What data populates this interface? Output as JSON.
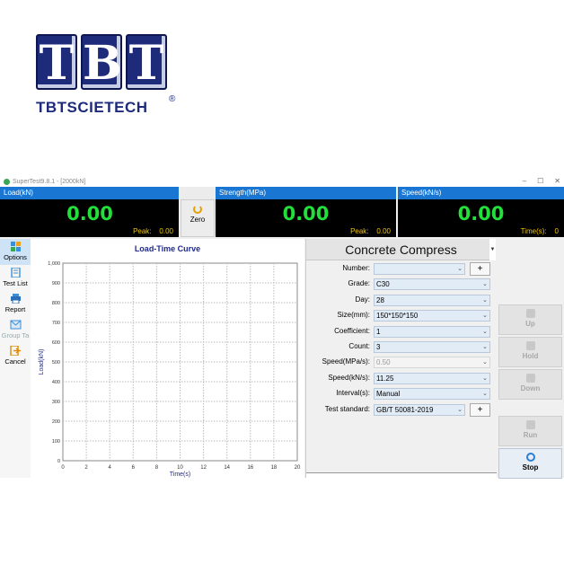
{
  "logo": {
    "letters": [
      "T",
      "B",
      "T"
    ],
    "brand": "TBTSCIETECH",
    "reg": "®"
  },
  "window": {
    "title": "SuperTest9.8.1 - [2000kN]",
    "controls": [
      "–",
      "☐",
      "✕"
    ]
  },
  "readouts": [
    {
      "label": "Load(kN)",
      "value": "0.00",
      "sub_label": "Peak:",
      "sub_value": "0.00"
    },
    {
      "label": "Strength(MPa)",
      "value": "0.00",
      "sub_label": "Peak:",
      "sub_value": "0.00"
    },
    {
      "label": "Speed(kN/s)",
      "value": "0.00",
      "sub_label": "Time(s):",
      "sub_value": "0"
    }
  ],
  "zero_button": "Zero",
  "toolbar": [
    {
      "label": "Options",
      "icon": "grid-icon",
      "active": true
    },
    {
      "label": "Test List",
      "icon": "list-icon",
      "active": false
    },
    {
      "label": "Report",
      "icon": "printer-icon",
      "active": false
    },
    {
      "label": "Group Ta",
      "icon": "envelope-icon",
      "active": false
    },
    {
      "label": "Cancel",
      "icon": "exit-icon",
      "active": false
    }
  ],
  "chart_data": {
    "type": "line",
    "title": "Load-Time Curve",
    "xlabel": "Time(s)",
    "ylabel": "Load(kN)",
    "xlim": [
      0,
      20
    ],
    "ylim": [
      0,
      1000
    ],
    "x_ticks": [
      0,
      2,
      4,
      6,
      8,
      10,
      12,
      14,
      16,
      18,
      20
    ],
    "y_ticks": [
      0,
      100,
      200,
      300,
      400,
      500,
      600,
      700,
      800,
      900,
      1000
    ],
    "y_tick_labels": [
      "0",
      "100",
      "200",
      "300",
      "400",
      "500",
      "600",
      "700",
      "800",
      "900",
      "1,000"
    ],
    "grid": true,
    "series": []
  },
  "params": {
    "header": "Concrete Compress",
    "rows": [
      {
        "label": "Number:",
        "value": "",
        "plus": true,
        "disabled": false
      },
      {
        "label": "Grade:",
        "value": "C30",
        "plus": false,
        "disabled": false
      },
      {
        "label": "Day:",
        "value": "28",
        "plus": false,
        "disabled": false
      },
      {
        "label": "Size(mm):",
        "value": "150*150*150",
        "plus": false,
        "disabled": false
      },
      {
        "label": "Coefficient:",
        "value": "1",
        "plus": false,
        "disabled": false
      },
      {
        "label": "Count:",
        "value": "3",
        "plus": false,
        "disabled": false
      },
      {
        "label": "Speed(MPa/s):",
        "value": "0.50",
        "plus": false,
        "disabled": true
      },
      {
        "label": "Speed(kN/s):",
        "value": "11.25",
        "plus": false,
        "disabled": false
      },
      {
        "label": "Interval(s):",
        "value": "Manual",
        "plus": false,
        "disabled": false
      },
      {
        "label": "Test standard:",
        "value": "GB/T 50081-2019",
        "plus": true,
        "disabled": false
      }
    ],
    "plus_label": "+"
  },
  "controls": [
    {
      "label": "Up",
      "enabled": false
    },
    {
      "label": "Hold",
      "enabled": false
    },
    {
      "label": "Down",
      "enabled": false
    },
    {
      "label": "Run",
      "enabled": false
    },
    {
      "label": "Stop",
      "enabled": true
    }
  ],
  "colors": {
    "accent": "#1976d2",
    "digits": "#22e03a",
    "peak": "#f2c400",
    "chart_title": "#1f2a8a"
  }
}
